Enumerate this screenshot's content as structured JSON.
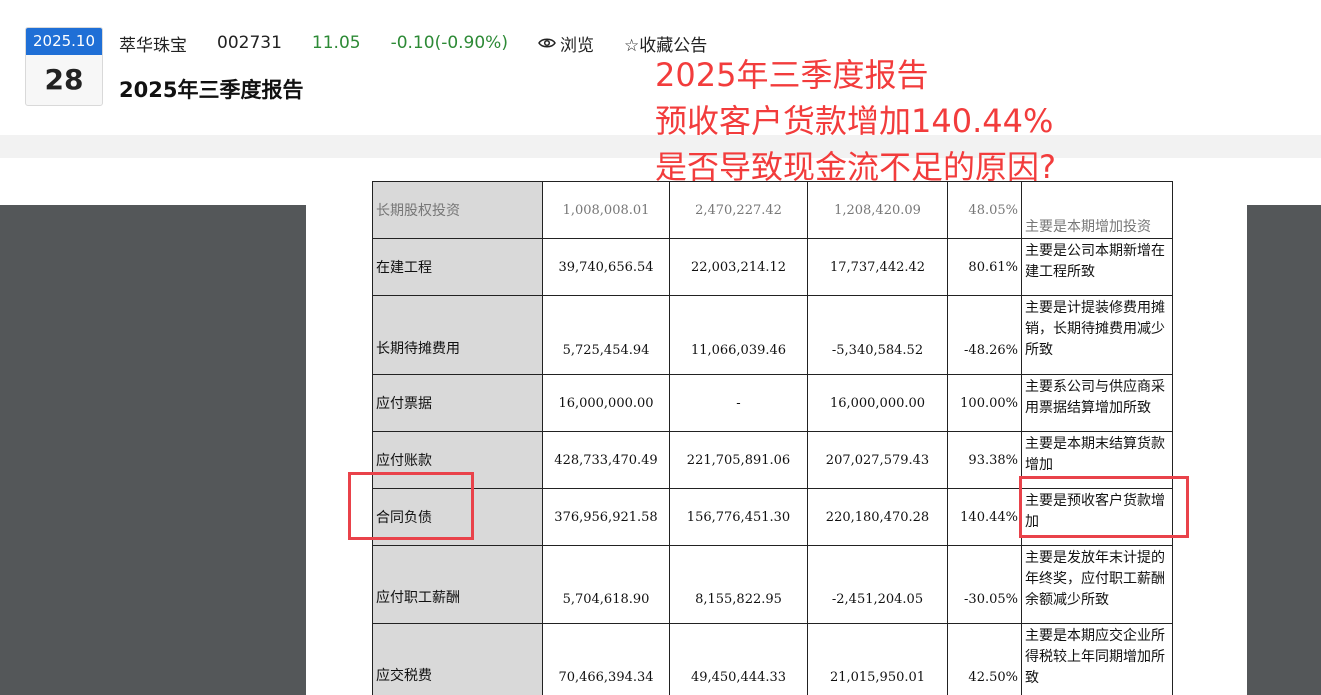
{
  "header": {
    "date_month": "2025.10",
    "date_day": "28",
    "stock_name": "萃华珠宝",
    "stock_code": "002731",
    "price": "11.05",
    "change": "-0.10(-0.90%)",
    "browse_label": "浏览",
    "favorite_label": "☆收藏公告",
    "report_title": "2025年三季度报告"
  },
  "annotation": {
    "line1": "2025年三季度报告",
    "line2": "预收客户货款增加140.44%",
    "line3": "是否导致现金流不足的原因?"
  },
  "colors": {
    "accent_blue": "#1f6fd6",
    "price_green": "#2d8a36",
    "annotation_red": "#f23c3c",
    "highlight_red": "#e9424a",
    "viewer_bg": "#545759"
  },
  "table": {
    "rows": [
      {
        "label": "长期股权投资",
        "v1": "1,008,008.01",
        "v2": "2,470,227.42",
        "v3": "1,208,420.09",
        "pct": "48.05%",
        "note": "主要是本期增加投资"
      },
      {
        "label": "在建工程",
        "v1": "39,740,656.54",
        "v2": "22,003,214.12",
        "v3": "17,737,442.42",
        "pct": "80.61%",
        "note": "主要是公司本期新增在建工程所致"
      },
      {
        "label": "长期待摊费用",
        "v1": "5,725,454.94",
        "v2": "11,066,039.46",
        "v3": "-5,340,584.52",
        "pct": "-48.26%",
        "note": "主要是计提装修费用摊销，长期待摊费用减少所致"
      },
      {
        "label": "应付票据",
        "v1": "16,000,000.00",
        "v2": "-",
        "v3": "16,000,000.00",
        "pct": "100.00%",
        "note": "主要系公司与供应商采用票据结算增加所致"
      },
      {
        "label": "应付账款",
        "v1": "428,733,470.49",
        "v2": "221,705,891.06",
        "v3": "207,027,579.43",
        "pct": "93.38%",
        "note": "主要是本期末结算货款增加"
      },
      {
        "label": "合同负债",
        "v1": "376,956,921.58",
        "v2": "156,776,451.30",
        "v3": "220,180,470.28",
        "pct": "140.44%",
        "note": "主要是预收客户货款增加"
      },
      {
        "label": "应付职工薪酬",
        "v1": "5,704,618.90",
        "v2": "8,155,822.95",
        "v3": "-2,451,204.05",
        "pct": "-30.05%",
        "note": "主要是发放年末计提的年终奖，应付职工薪酬余额减少所致"
      },
      {
        "label": "应交税费",
        "v1": "70,466,394.34",
        "v2": "49,450,444.33",
        "v3": "21,015,950.01",
        "pct": "42.50%",
        "note": "主要是本期应交企业所得税较上年同期增加所致"
      }
    ]
  }
}
